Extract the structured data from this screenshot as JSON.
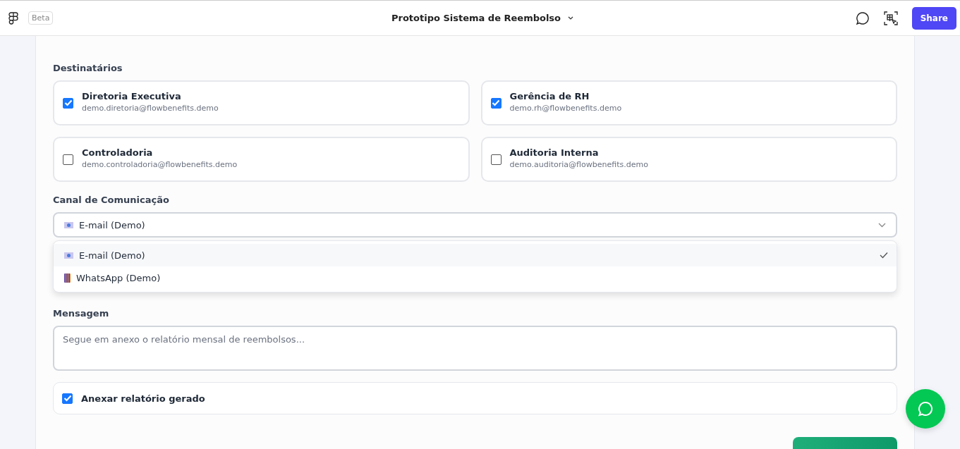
{
  "header": {
    "badge": "Beta",
    "title": "Prototipo Sistema de Reembolso",
    "share": "Share"
  },
  "recipients_label": "Destinatários",
  "recipients": [
    {
      "name": "Diretoria Executiva",
      "email": "demo.diretoria@flowbenefits.demo",
      "checked": true
    },
    {
      "name": "Gerência de RH",
      "email": "demo.rh@flowbenefits.demo",
      "checked": true
    },
    {
      "name": "Controladoria",
      "email": "demo.controladoria@flowbenefits.demo",
      "checked": false
    },
    {
      "name": "Auditoria Interna",
      "email": "demo.auditoria@flowbenefits.demo",
      "checked": false
    }
  ],
  "channel_label": "Canal de Comunicação",
  "channel_value": {
    "kind": "email",
    "label": "E-mail (Demo)"
  },
  "channel_options": [
    {
      "kind": "email",
      "label": "E-mail (Demo)",
      "selected": true
    },
    {
      "kind": "phone",
      "label": "WhatsApp (Demo)",
      "selected": false
    }
  ],
  "message_label": "Mensagem",
  "message": {
    "placeholder": "Segue em anexo o relatório mensal de reembolsos..."
  },
  "attach": {
    "label": "Anexar relatório gerado",
    "checked": true
  }
}
